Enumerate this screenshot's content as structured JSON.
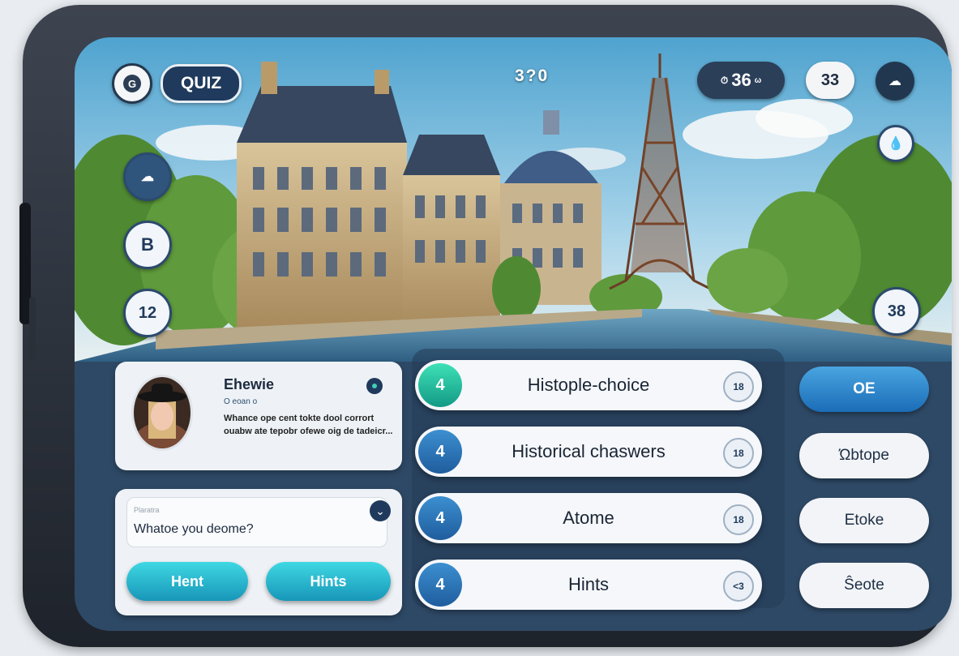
{
  "header": {
    "logo_letter": "G",
    "quiz_label": "QUIZ",
    "score": "3?0",
    "timer_value": "36",
    "timer_unit": "ω",
    "question_count": "33"
  },
  "left_rail": [
    "",
    "B",
    "12"
  ],
  "right_badge": "38",
  "profile": {
    "name": "Ehewie",
    "subline": "O eoan o",
    "text": "Whance ope cent tokte dool corrort ouabw ate tepobr ofewe oig de tadeicr..."
  },
  "question_box": {
    "tiny_label": "Plaratra",
    "prompt": "Whatoe you deome?"
  },
  "bottom_buttons": {
    "left": "Hent",
    "right": "Hints"
  },
  "answers": [
    {
      "num": "4",
      "label": "Histople-choice",
      "badge": "18",
      "active": true
    },
    {
      "num": "4",
      "label": "Historical chaswers",
      "badge": "18",
      "active": false
    },
    {
      "num": "4",
      "label": "Atome",
      "badge": "18",
      "active": false
    },
    {
      "num": "4",
      "label": "Hints",
      "badge": "<3",
      "active": false
    }
  ],
  "side_options": [
    "OE",
    "Ώbtope",
    "Etoke",
    "Ŝeote"
  ],
  "colors": {
    "accent_teal": "#3ed1b7",
    "accent_blue": "#1b6db7",
    "panel_dark": "#1f3a5c"
  }
}
